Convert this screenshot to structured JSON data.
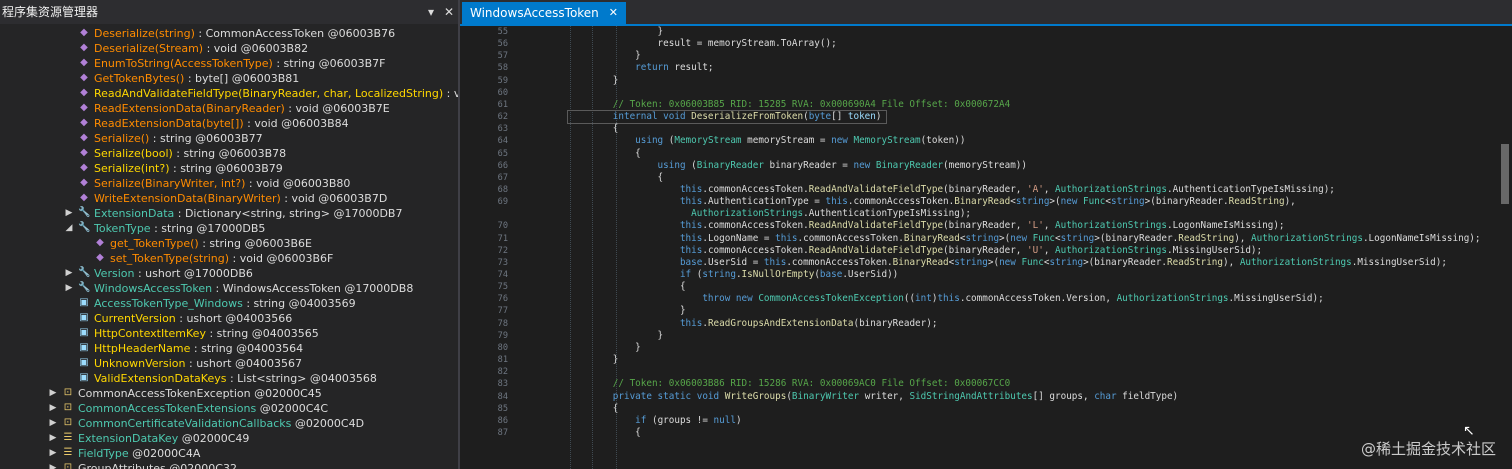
{
  "explorer": {
    "title": "程序集资源管理器",
    "pin_glyph": "▾",
    "close_glyph": "✕",
    "rows": [
      {
        "indent": 1,
        "icon": "method",
        "name": "Deserialize(string)",
        "nc": "name-orange",
        "rest": " : CommonAccessToken @06003B76"
      },
      {
        "indent": 1,
        "icon": "method",
        "name": "Deserialize(Stream)",
        "nc": "name-orange",
        "rest": " : void @06003B82"
      },
      {
        "indent": 1,
        "icon": "method",
        "name": "EnumToString(AccessTokenType)",
        "nc": "name-orange",
        "rest": " : string @06003B7F"
      },
      {
        "indent": 1,
        "icon": "method",
        "name": "GetTokenBytes()",
        "nc": "name-orange",
        "rest": " : byte[] @06003B81"
      },
      {
        "indent": 1,
        "icon": "method",
        "name": "ReadAndValidateFieldType(BinaryReader, char, LocalizedString)",
        "nc": "name-yellow",
        "rest": " : void"
      },
      {
        "indent": 1,
        "icon": "method",
        "name": "ReadExtensionData(BinaryReader)",
        "nc": "name-orange",
        "rest": " : void @06003B7E"
      },
      {
        "indent": 1,
        "icon": "method",
        "name": "ReadExtensionData(byte[])",
        "nc": "name-orange",
        "rest": " : void @06003B84"
      },
      {
        "indent": 1,
        "icon": "method",
        "name": "Serialize()",
        "nc": "name-orange",
        "rest": " : string @06003B77"
      },
      {
        "indent": 1,
        "icon": "method",
        "name": "Serialize(bool)",
        "nc": "name-yellow",
        "rest": " : string @06003B78"
      },
      {
        "indent": 1,
        "icon": "method",
        "name": "Serialize(int?)",
        "nc": "name-yellow",
        "rest": " : string @06003B79"
      },
      {
        "indent": 1,
        "icon": "method",
        "name": "Serialize(BinaryWriter, int?)",
        "nc": "name-orange",
        "rest": " : void @06003B80"
      },
      {
        "indent": 1,
        "icon": "method",
        "name": "WriteExtensionData(BinaryWriter)",
        "nc": "name-orange",
        "rest": " : void @06003B7D"
      },
      {
        "indent": 1,
        "icon": "property",
        "arrow": "▶",
        "name": "ExtensionData",
        "nc": "name-cyan",
        "rest": " : Dictionary<string, string> @17000DB7"
      },
      {
        "indent": 1,
        "icon": "property",
        "arrow": "◢",
        "name": "TokenType",
        "nc": "name-cyan",
        "rest": " : string @17000DB5"
      },
      {
        "indent": 2,
        "icon": "method",
        "name": "get_TokenType()",
        "nc": "name-orange",
        "rest": " : string @06003B6E"
      },
      {
        "indent": 2,
        "icon": "method",
        "name": "set_TokenType(string)",
        "nc": "name-orange",
        "rest": " : void @06003B6F"
      },
      {
        "indent": 1,
        "icon": "property",
        "arrow": "▶",
        "name": "Version",
        "nc": "name-cyan",
        "rest": " : ushort @17000DB6"
      },
      {
        "indent": 1,
        "icon": "property",
        "arrow": "▶",
        "name": "WindowsAccessToken",
        "nc": "name-cyan",
        "rest": " : WindowsAccessToken @17000DB8"
      },
      {
        "indent": 1,
        "icon": "field",
        "name": "AccessTokenType_Windows",
        "nc": "name-cyan",
        "rest": " : string @04003569"
      },
      {
        "indent": 1,
        "icon": "field",
        "name": "CurrentVersion",
        "nc": "name-yellow",
        "rest": " : ushort @04003566"
      },
      {
        "indent": 1,
        "icon": "field",
        "name": "HttpContextItemKey",
        "nc": "name-yellow",
        "rest": " : string @04003565"
      },
      {
        "indent": 1,
        "icon": "field",
        "name": "HttpHeaderName",
        "nc": "name-yellow",
        "rest": " : string @04003564"
      },
      {
        "indent": 1,
        "icon": "field",
        "name": "UnknownVersion",
        "nc": "name-yellow",
        "rest": " : ushort @04003567"
      },
      {
        "indent": 1,
        "icon": "field",
        "name": "ValidExtensionDataKeys",
        "nc": "name-yellow",
        "rest": " : List<string> @04003568"
      },
      {
        "indent": 0,
        "icon": "class",
        "arrow": "▶",
        "name": "CommonAccessTokenException",
        "nc": "name-white",
        "rest": " @02000C45"
      },
      {
        "indent": 0,
        "icon": "class",
        "arrow": "▶",
        "name": "CommonAccessTokenExtensions",
        "nc": "name-cyan",
        "rest": " @02000C4C"
      },
      {
        "indent": 0,
        "icon": "class",
        "arrow": "▶",
        "name": "CommonCertificateValidationCallbacks",
        "nc": "name-cyan",
        "rest": " @02000C4D"
      },
      {
        "indent": 0,
        "icon": "enum",
        "arrow": "▶",
        "name": "ExtensionDataKey",
        "nc": "name-cyan",
        "rest": " @02000C49"
      },
      {
        "indent": 0,
        "icon": "enum",
        "arrow": "▶",
        "name": "FieldType",
        "nc": "name-cyan",
        "rest": " @02000C4A"
      },
      {
        "indent": 0,
        "icon": "class",
        "arrow": "▶",
        "name": "GroupAttributes",
        "nc": "name-white",
        "rest": " @02000C32"
      }
    ]
  },
  "editor": {
    "tab_label": "WindowsAccessToken",
    "tab_close": "✕",
    "lines": [
      {
        "n": "55",
        "t": [
          [
            "",
            "                }"
          ]
        ]
      },
      {
        "n": "56",
        "t": [
          [
            "",
            "                result = memoryStream.ToArray();"
          ]
        ]
      },
      {
        "n": "57",
        "t": [
          [
            "",
            "            }"
          ]
        ]
      },
      {
        "n": "58",
        "t": [
          [
            "kw",
            "            return"
          ],
          [
            "",
            " result;"
          ]
        ]
      },
      {
        "n": "59",
        "t": [
          [
            "",
            "        }"
          ]
        ]
      },
      {
        "n": "60",
        "t": [
          [
            "",
            ""
          ]
        ]
      },
      {
        "n": "61",
        "t": [
          [
            "cm",
            "        // Token: 0x06003B85 RID: 15285 RVA: 0x000690A4 File Offset: 0x000672A4"
          ]
        ]
      },
      {
        "n": "62",
        "t": [
          [
            "kw",
            "        internal void "
          ],
          [
            "mt",
            "DeserializeFromToken"
          ],
          [
            "",
            "("
          ],
          [
            "kw",
            "byte"
          ],
          [
            "",
            "[] "
          ],
          [
            "prm",
            "token"
          ],
          [
            "",
            ")"
          ]
        ],
        "box": true
      },
      {
        "n": "63",
        "t": [
          [
            "",
            "        {"
          ]
        ]
      },
      {
        "n": "64",
        "t": [
          [
            "kw",
            "            using"
          ],
          [
            "",
            " ("
          ],
          [
            "ty",
            "MemoryStream"
          ],
          [
            "",
            " memoryStream = "
          ],
          [
            "kw",
            "new"
          ],
          [
            "ty",
            " MemoryStream"
          ],
          [
            "",
            "(token))"
          ]
        ]
      },
      {
        "n": "65",
        "t": [
          [
            "",
            "            {"
          ]
        ]
      },
      {
        "n": "66",
        "t": [
          [
            "kw",
            "                using"
          ],
          [
            "",
            " ("
          ],
          [
            "ty",
            "BinaryReader"
          ],
          [
            "",
            " binaryReader = "
          ],
          [
            "kw",
            "new"
          ],
          [
            "ty",
            " BinaryReader"
          ],
          [
            "",
            "(memoryStream))"
          ]
        ]
      },
      {
        "n": "67",
        "t": [
          [
            "",
            "                {"
          ]
        ]
      },
      {
        "n": "68",
        "t": [
          [
            "kw",
            "                    this"
          ],
          [
            "",
            ".commonAccessToken."
          ],
          [
            "mt",
            "ReadAndValidateFieldType"
          ],
          [
            "",
            "(binaryReader, "
          ],
          [
            "st",
            "'A'"
          ],
          [
            "",
            ", "
          ],
          [
            "ty",
            "AuthorizationStrings"
          ],
          [
            "",
            ".AuthenticationTypeIsMissing);"
          ]
        ]
      },
      {
        "n": "69",
        "t": [
          [
            "kw",
            "                    this"
          ],
          [
            "",
            ".AuthenticationType = "
          ],
          [
            "kw",
            "this"
          ],
          [
            "",
            ".commonAccessToken."
          ],
          [
            "mt",
            "BinaryRead"
          ],
          [
            "",
            "<"
          ],
          [
            "kw",
            "string"
          ],
          [
            "",
            ">("
          ],
          [
            "kw",
            "new"
          ],
          [
            "ty",
            " Func"
          ],
          [
            "",
            "<"
          ],
          [
            "kw",
            "string"
          ],
          [
            "",
            ">(binaryReader."
          ],
          [
            "mt",
            "ReadString"
          ],
          [
            "",
            "),"
          ]
        ]
      },
      {
        "n": "",
        "t": [
          [
            "ty",
            "                      AuthorizationStrings"
          ],
          [
            "",
            ".AuthenticationTypeIsMissing);"
          ]
        ]
      },
      {
        "n": "70",
        "t": [
          [
            "kw",
            "                    this"
          ],
          [
            "",
            ".commonAccessToken."
          ],
          [
            "mt",
            "ReadAndValidateFieldType"
          ],
          [
            "",
            "(binaryReader, "
          ],
          [
            "st",
            "'L'"
          ],
          [
            "",
            ", "
          ],
          [
            "ty",
            "AuthorizationStrings"
          ],
          [
            "",
            ".LogonNameIsMissing);"
          ]
        ]
      },
      {
        "n": "71",
        "t": [
          [
            "kw",
            "                    this"
          ],
          [
            "",
            ".LogonName = "
          ],
          [
            "kw",
            "this"
          ],
          [
            "",
            ".commonAccessToken."
          ],
          [
            "mt",
            "BinaryRead"
          ],
          [
            "",
            "<"
          ],
          [
            "kw",
            "string"
          ],
          [
            "",
            ">("
          ],
          [
            "kw",
            "new"
          ],
          [
            "ty",
            " Func"
          ],
          [
            "",
            "<"
          ],
          [
            "kw",
            "string"
          ],
          [
            "",
            ">(binaryReader."
          ],
          [
            "mt",
            "ReadString"
          ],
          [
            "",
            "), "
          ],
          [
            "ty",
            "AuthorizationStrings"
          ],
          [
            "",
            ".LogonNameIsMissing);"
          ]
        ]
      },
      {
        "n": "72",
        "t": [
          [
            "kw",
            "                    this"
          ],
          [
            "",
            ".commonAccessToken."
          ],
          [
            "mt",
            "ReadAndValidateFieldType"
          ],
          [
            "",
            "(binaryReader, "
          ],
          [
            "st",
            "'U'"
          ],
          [
            "",
            ", "
          ],
          [
            "ty",
            "AuthorizationStrings"
          ],
          [
            "",
            ".MissingUserSid);"
          ]
        ]
      },
      {
        "n": "73",
        "t": [
          [
            "kw",
            "                    base"
          ],
          [
            "",
            ".UserSid = "
          ],
          [
            "kw",
            "this"
          ],
          [
            "",
            ".commonAccessToken."
          ],
          [
            "mt",
            "BinaryRead"
          ],
          [
            "",
            "<"
          ],
          [
            "kw",
            "string"
          ],
          [
            "",
            ">("
          ],
          [
            "kw",
            "new"
          ],
          [
            "ty",
            " Func"
          ],
          [
            "",
            "<"
          ],
          [
            "kw",
            "string"
          ],
          [
            "",
            ">(binaryReader."
          ],
          [
            "mt",
            "ReadString"
          ],
          [
            "",
            "), "
          ],
          [
            "ty",
            "AuthorizationStrings"
          ],
          [
            "",
            ".MissingUserSid);"
          ]
        ]
      },
      {
        "n": "74",
        "t": [
          [
            "kw",
            "                    if"
          ],
          [
            "",
            " ("
          ],
          [
            "kw",
            "string"
          ],
          [
            "",
            "."
          ],
          [
            "mt",
            "IsNullOrEmpty"
          ],
          [
            "",
            "("
          ],
          [
            "kw",
            "base"
          ],
          [
            "",
            ".UserSid))"
          ]
        ]
      },
      {
        "n": "75",
        "t": [
          [
            "",
            "                    {"
          ]
        ]
      },
      {
        "n": "76",
        "t": [
          [
            "kw",
            "                        throw new"
          ],
          [
            "ty",
            " CommonAccessTokenException"
          ],
          [
            "",
            "(("
          ],
          [
            "kw",
            "int"
          ],
          [
            "",
            ")"
          ],
          [
            "kw",
            "this"
          ],
          [
            "",
            ".commonAccessToken.Version, "
          ],
          [
            "ty",
            "AuthorizationStrings"
          ],
          [
            "",
            ".MissingUserSid);"
          ]
        ]
      },
      {
        "n": "77",
        "t": [
          [
            "",
            "                    }"
          ]
        ]
      },
      {
        "n": "78",
        "t": [
          [
            "kw",
            "                    this"
          ],
          [
            "",
            "."
          ],
          [
            "mt",
            "ReadGroupsAndExtensionData"
          ],
          [
            "",
            "(binaryReader);"
          ]
        ]
      },
      {
        "n": "79",
        "t": [
          [
            "",
            "                }"
          ]
        ]
      },
      {
        "n": "80",
        "t": [
          [
            "",
            "            }"
          ]
        ]
      },
      {
        "n": "81",
        "t": [
          [
            "",
            "        }"
          ]
        ]
      },
      {
        "n": "82",
        "t": [
          [
            "",
            ""
          ]
        ]
      },
      {
        "n": "83",
        "t": [
          [
            "cm",
            "        // Token: 0x06003B86 RID: 15286 RVA: 0x00069AC0 File Offset: 0x00067CC0"
          ]
        ]
      },
      {
        "n": "84",
        "t": [
          [
            "kw",
            "        private static void "
          ],
          [
            "mt",
            "WriteGroups"
          ],
          [
            "",
            "("
          ],
          [
            "ty",
            "BinaryWriter"
          ],
          [
            "",
            " writer, "
          ],
          [
            "ty",
            "SidStringAndAttributes"
          ],
          [
            "",
            "[] groups, "
          ],
          [
            "kw",
            "char"
          ],
          [
            "",
            " fieldType)"
          ]
        ]
      },
      {
        "n": "85",
        "t": [
          [
            "",
            "        {"
          ]
        ]
      },
      {
        "n": "86",
        "t": [
          [
            "kw",
            "            if"
          ],
          [
            "",
            " (groups != "
          ],
          [
            "kw",
            "null"
          ],
          [
            "",
            ")"
          ]
        ]
      },
      {
        "n": "87",
        "t": [
          [
            "",
            "            {"
          ]
        ]
      }
    ]
  },
  "watermark": "@稀土掘金技术社区"
}
